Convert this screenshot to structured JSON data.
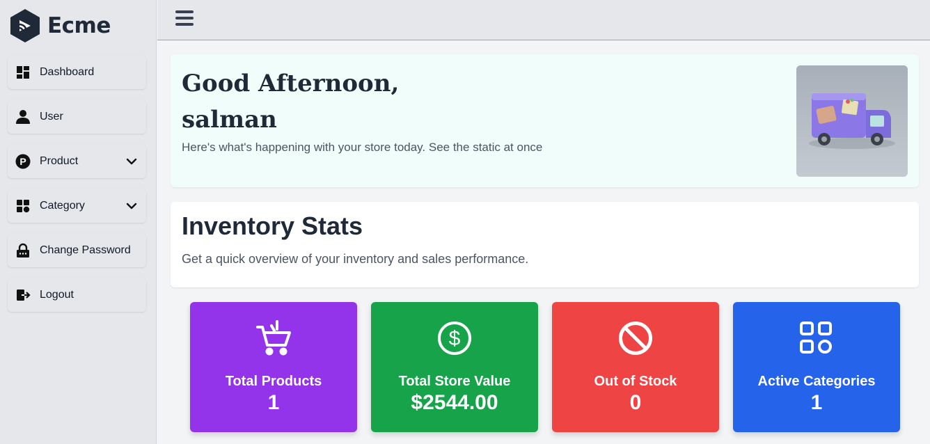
{
  "app": {
    "name": "Ecme"
  },
  "sidebar": {
    "items": [
      {
        "label": "Dashboard",
        "icon": "dashboard-icon"
      },
      {
        "label": "User",
        "icon": "user-icon"
      },
      {
        "label": "Product",
        "icon": "product-p-icon",
        "expandable": true
      },
      {
        "label": "Category",
        "icon": "category-icon",
        "expandable": true
      },
      {
        "label": "Change Password",
        "icon": "lock-icon"
      },
      {
        "label": "Logout",
        "icon": "logout-icon"
      }
    ]
  },
  "topbar": {
    "menu_icon": "hamburger-icon"
  },
  "welcome": {
    "greeting": "Good Afternoon,",
    "username": "salman",
    "subtitle": "Here's what's happening with your store today. See the static at once"
  },
  "inventory": {
    "title": "Inventory Stats",
    "subtitle": "Get a quick overview of your inventory and sales performance."
  },
  "stats": [
    {
      "label": "Total Products",
      "value": "1",
      "icon": "cart-icon",
      "color": "#9333ea"
    },
    {
      "label": "Total Store Value",
      "value": "$2544.00",
      "icon": "dollar-icon",
      "color": "#16a34a"
    },
    {
      "label": "Out of Stock",
      "value": "0",
      "icon": "ban-icon",
      "color": "#ef4444"
    },
    {
      "label": "Active Categories",
      "value": "1",
      "icon": "apps-icon",
      "color": "#2563eb"
    }
  ]
}
